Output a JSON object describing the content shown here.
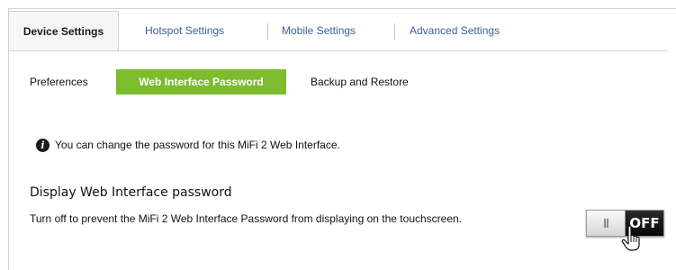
{
  "tabs": [
    {
      "label": "Device Settings",
      "active": true
    },
    {
      "label": "Hotspot Settings"
    },
    {
      "label": "Mobile Settings"
    },
    {
      "label": "Advanced Settings"
    }
  ],
  "subnav": [
    {
      "label": "Preferences"
    },
    {
      "label": "Web Interface Password",
      "active": true
    },
    {
      "label": "Backup and Restore"
    }
  ],
  "info": {
    "icon": "info-icon",
    "text": "You can change the password for this MiFi 2 Web Interface."
  },
  "section": {
    "heading": "Display Web Interface password",
    "description": "Turn off to prevent the MiFi 2 Web Interface Password from displaying on the touchscreen."
  },
  "toggle": {
    "state_label": "OFF",
    "on": false
  },
  "colors": {
    "accent_green": "#7dbb2f",
    "tab_link": "#3b5f9a"
  }
}
